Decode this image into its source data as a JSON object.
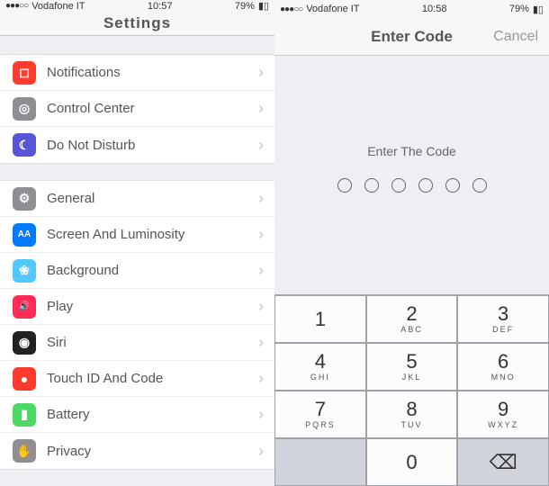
{
  "left": {
    "status": {
      "carrier": "Vodafone IT",
      "time": "10:57",
      "battery": "79%"
    },
    "nav": {
      "title": "Settings"
    },
    "section1": [
      {
        "label": "Notifications",
        "icon_bg": "#ff3b30",
        "icon_glyph": "◻"
      },
      {
        "label": "Control Center",
        "icon_bg": "#8e8e93",
        "icon_glyph": "◎"
      },
      {
        "label": "Do Not Disturb",
        "icon_bg": "#5856d6",
        "icon_glyph": "☾"
      }
    ],
    "section2": [
      {
        "label": "General",
        "icon_bg": "#8e8e93",
        "icon_glyph": "⚙"
      },
      {
        "label": "Screen And Luminosity",
        "icon_bg": "#007aff",
        "icon_glyph": "AA"
      },
      {
        "label": "Background",
        "icon_bg": "#54c7fc",
        "icon_glyph": "❀"
      },
      {
        "label": "Play",
        "icon_bg": "#ff2d55",
        "icon_glyph": "🔊"
      },
      {
        "label": "Siri",
        "icon_bg": "#222",
        "icon_glyph": "◉"
      },
      {
        "label": "Touch ID And Code",
        "icon_bg": "#ff3b30",
        "icon_glyph": "●"
      },
      {
        "label": "Battery",
        "icon_bg": "#4cd964",
        "icon_glyph": "▮"
      },
      {
        "label": "Privacy",
        "icon_bg": "#8e8e93",
        "icon_glyph": "✋"
      }
    ]
  },
  "right": {
    "status": {
      "carrier": "Vodafone IT",
      "time": "10:58",
      "battery": "79%"
    },
    "nav": {
      "title": "Enter Code",
      "cancel": "Cancel"
    },
    "prompt": "Enter The Code",
    "keypad": [
      {
        "num": "1",
        "sub": ""
      },
      {
        "num": "2",
        "sub": "ABC"
      },
      {
        "num": "3",
        "sub": "DEF"
      },
      {
        "num": "4",
        "sub": "GHI"
      },
      {
        "num": "5",
        "sub": "JKL"
      },
      {
        "num": "6",
        "sub": "MNO"
      },
      {
        "num": "7",
        "sub": "PQRS"
      },
      {
        "num": "8",
        "sub": "TUV"
      },
      {
        "num": "9",
        "sub": "WXYZ"
      },
      {
        "num": "",
        "sub": "",
        "blank": true
      },
      {
        "num": "0",
        "sub": ""
      },
      {
        "num": "",
        "sub": "",
        "back": true
      }
    ]
  }
}
